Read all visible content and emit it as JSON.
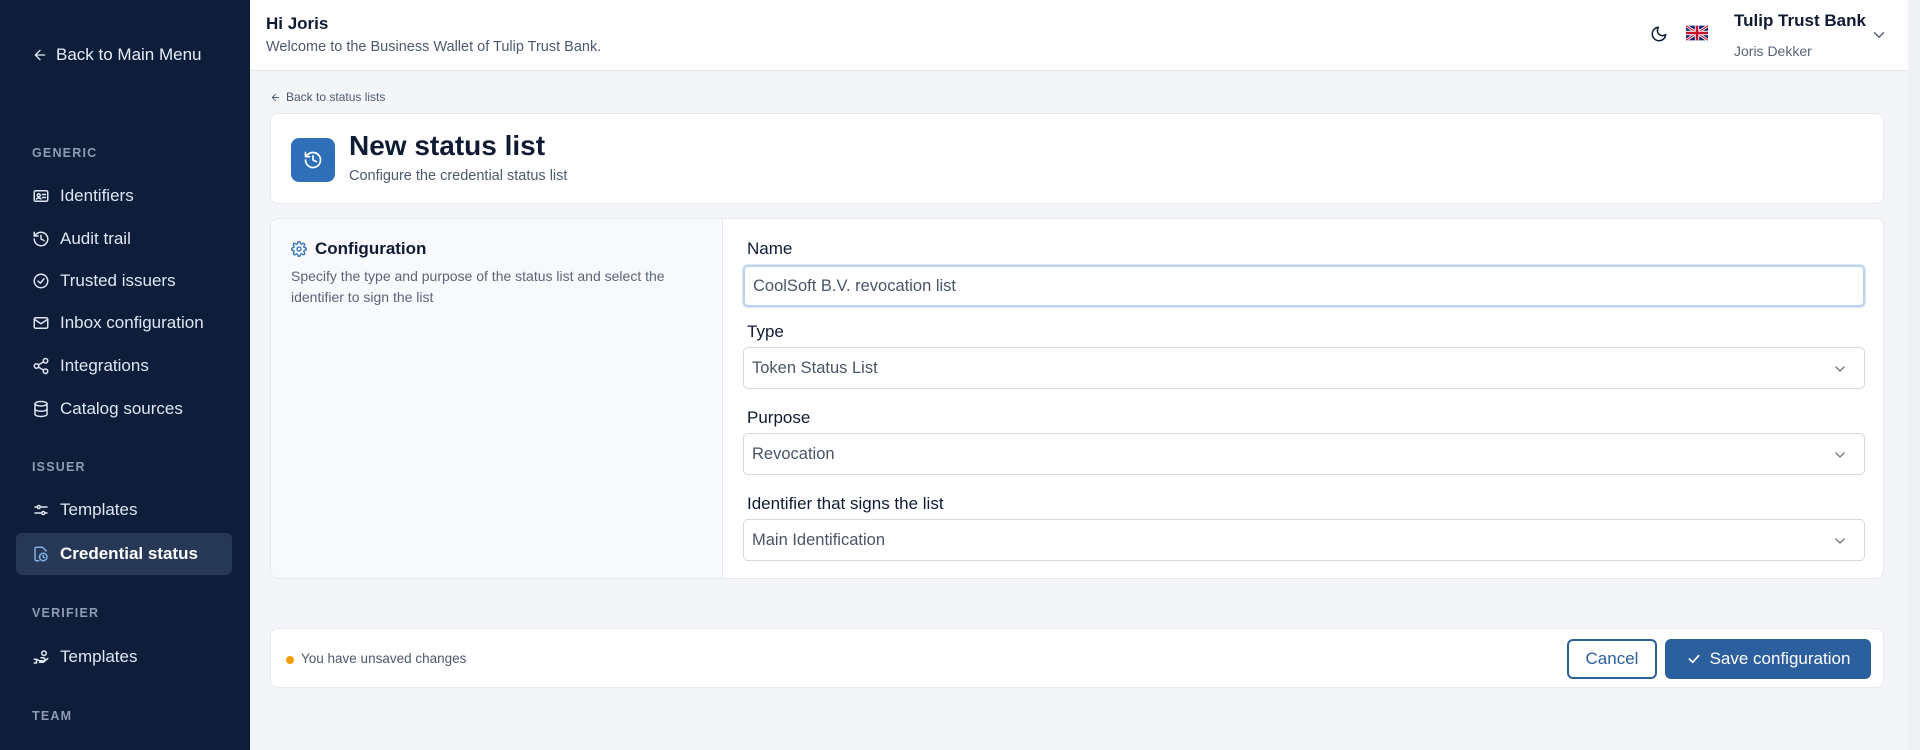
{
  "sidebar": {
    "back_label": "Back to Main Menu",
    "sections": {
      "generic": "GENERIC",
      "issuer": "ISSUER",
      "verifier": "VERIFIER",
      "team": "TEAM"
    },
    "items": {
      "identifiers": "Identifiers",
      "audit_trail": "Audit trail",
      "trusted_issuers": "Trusted issuers",
      "inbox_configuration": "Inbox configuration",
      "integrations": "Integrations",
      "catalog_sources": "Catalog sources",
      "issuer_templates": "Templates",
      "credential_status": "Credential status",
      "verifier_templates": "Templates"
    },
    "active_item": "credential_status"
  },
  "header": {
    "greeting": "Hi Joris",
    "welcome": "Welcome to the Business Wallet of Tulip Trust Bank.",
    "organization": "Tulip Trust Bank",
    "user_name": "Joris Dekker",
    "icons": [
      "moon-icon",
      "uk-flag-icon",
      "chevron-down-icon"
    ]
  },
  "page": {
    "back_link": "Back to status lists",
    "title": "New status list",
    "subtitle": "Configure the credential status list"
  },
  "configuration": {
    "heading": "Configuration",
    "description": "Specify the type and purpose of the status list and select the identifier to sign the list",
    "name_label": "Name",
    "name_value": "CoolSoft B.V. revocation list",
    "type_label": "Type",
    "type_value": "Token Status List",
    "purpose_label": "Purpose",
    "purpose_value": "Revocation",
    "identifier_label": "Identifier that signs the list",
    "identifier_value": "Main Identification"
  },
  "footer": {
    "unsaved": "You have unsaved changes",
    "cancel_label": "Cancel",
    "save_label": "Save configuration"
  },
  "colors": {
    "sidebar_bg": "#0e1d3a",
    "accent": "#2c5f9e",
    "warning_dot": "#f59e0b",
    "page_bg": "#f3f5f9"
  }
}
